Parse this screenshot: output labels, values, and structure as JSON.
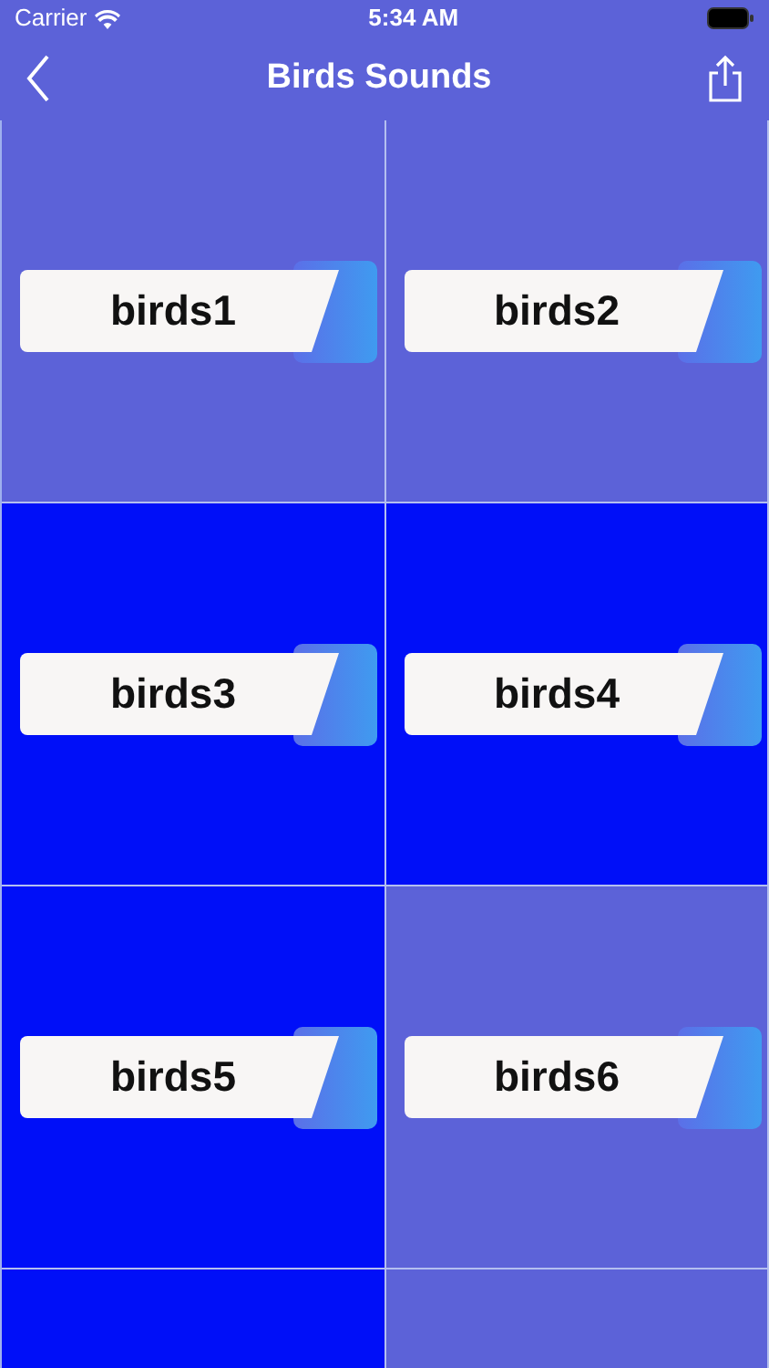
{
  "status_bar": {
    "carrier": "Carrier",
    "time": "5:34 AM"
  },
  "nav_bar": {
    "title": "Birds Sounds"
  },
  "tiles": [
    {
      "label": "birds1",
      "color": "#5c62d8"
    },
    {
      "label": "birds2",
      "color": "#5c62d8"
    },
    {
      "label": "birds3",
      "color": "#000ff8"
    },
    {
      "label": "birds4",
      "color": "#000ff8"
    },
    {
      "label": "birds5",
      "color": "#000ff8"
    },
    {
      "label": "birds6",
      "color": "#5c62d8"
    },
    {
      "color": "#000ff8"
    },
    {
      "color": "#5c62d8"
    }
  ]
}
